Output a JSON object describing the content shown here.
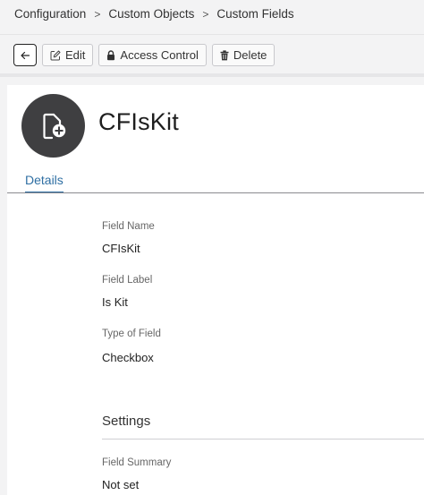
{
  "breadcrumb": {
    "items": [
      "Configuration",
      "Custom Objects",
      "Custom Fields"
    ],
    "separator": ">"
  },
  "toolbar": {
    "back_icon": "arrow-left-icon",
    "edit_label": "Edit",
    "access_label": "Access Control",
    "delete_label": "Delete"
  },
  "record": {
    "title": "CFIsKit",
    "avatar_icon": "document-add-icon",
    "avatar_color": "#3f3f41"
  },
  "tabs": [
    {
      "label": "Details",
      "active": true
    }
  ],
  "details": {
    "fields": [
      {
        "label": "Field Name",
        "value": "CFIsKit"
      },
      {
        "label": "Field Label",
        "value": "Is Kit"
      },
      {
        "label": "Type of Field",
        "value": "Checkbox"
      }
    ],
    "settings": {
      "title": "Settings",
      "fields": [
        {
          "label": "Field Summary",
          "value": "Not set"
        }
      ]
    }
  },
  "colors": {
    "accent": "#2f6fa3",
    "page_bg": "#f3f3f4",
    "card_bg": "#ffffff"
  }
}
